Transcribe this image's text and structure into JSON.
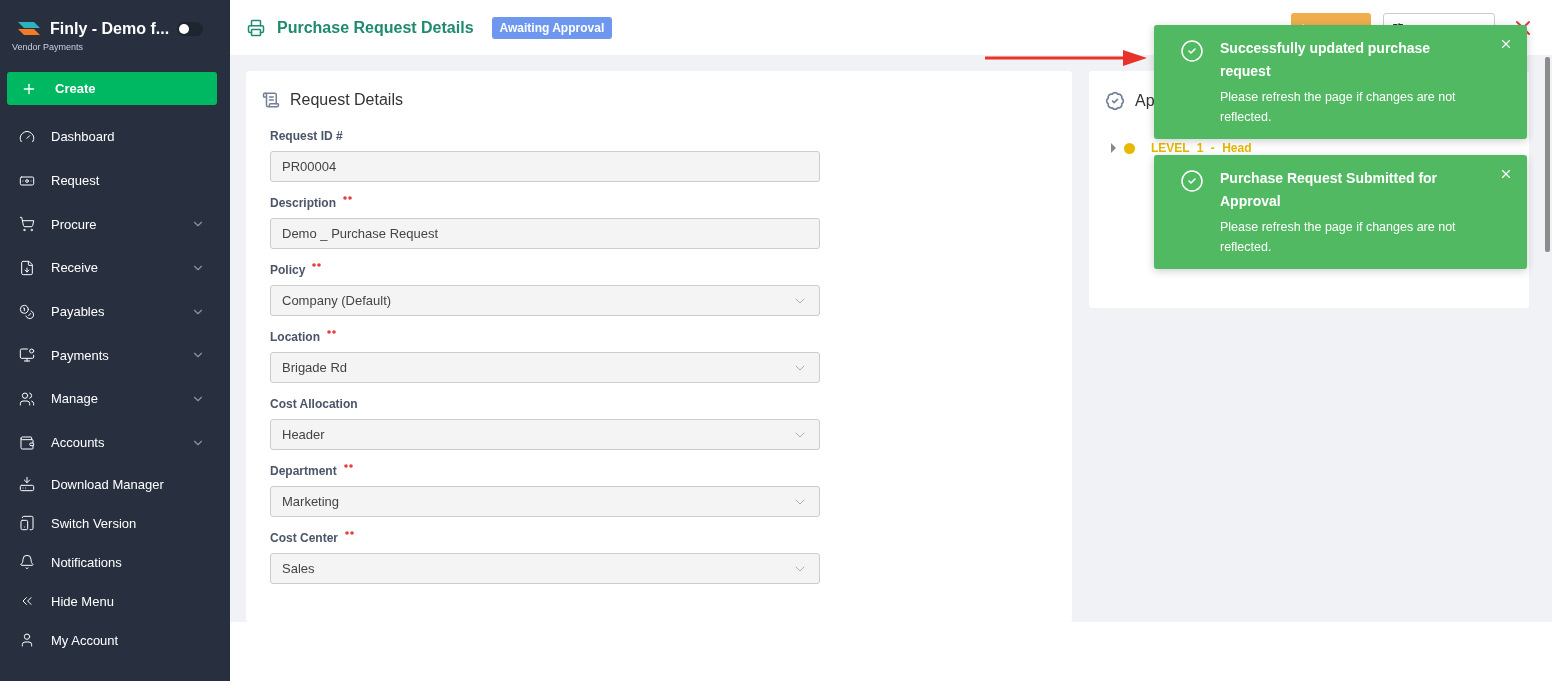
{
  "sidebar": {
    "brand": {
      "name": "Finly - Demo f...",
      "subtitle": "Vendor Payments",
      "toggle_on": false
    },
    "create_button": "Create",
    "items": [
      {
        "label": "Dashboard",
        "expandable": false
      },
      {
        "label": "Request",
        "expandable": false
      },
      {
        "label": "Procure",
        "expandable": true
      },
      {
        "label": "Receive",
        "expandable": true
      },
      {
        "label": "Payables",
        "expandable": true
      },
      {
        "label": "Payments",
        "expandable": true
      },
      {
        "label": "Manage",
        "expandable": true
      },
      {
        "label": "Accounts",
        "expandable": true
      }
    ],
    "footer_items": [
      {
        "label": "Download Manager"
      },
      {
        "label": "Switch Version"
      },
      {
        "label": "Notifications"
      },
      {
        "label": "Hide Menu"
      },
      {
        "label": "My Account"
      }
    ]
  },
  "header": {
    "title": "Purchase Request Details",
    "status": "Awaiting Approval"
  },
  "request_details": {
    "title": "Request Details",
    "fields": [
      {
        "label": "Request ID #",
        "required": false,
        "kind": "text",
        "value": "PR00004"
      },
      {
        "label": "Description",
        "required": true,
        "kind": "text",
        "value": "Demo _ Purchase Request"
      },
      {
        "label": "Policy",
        "required": true,
        "kind": "select",
        "value": "Company (Default)"
      },
      {
        "label": "Location",
        "required": true,
        "kind": "select",
        "value": "Brigade Rd"
      },
      {
        "label": "Cost Allocation",
        "required": false,
        "kind": "select",
        "value": "Header"
      },
      {
        "label": "Department",
        "required": true,
        "kind": "select",
        "value": "Marketing"
      },
      {
        "label": "Cost Center",
        "required": true,
        "kind": "select",
        "value": "Sales"
      }
    ]
  },
  "approval": {
    "title": "Ap",
    "levels": [
      {
        "label": "LEVEL 1 - Head",
        "color": "#e6b800",
        "expanded": false
      }
    ]
  },
  "toasts": [
    {
      "title": "Successfully updated purchase request",
      "message": "Please refresh the page if changes are not reflected."
    },
    {
      "title": "Purchase Request Submitted for Approval",
      "message": "Please refresh the page if changes are not reflected."
    }
  ]
}
